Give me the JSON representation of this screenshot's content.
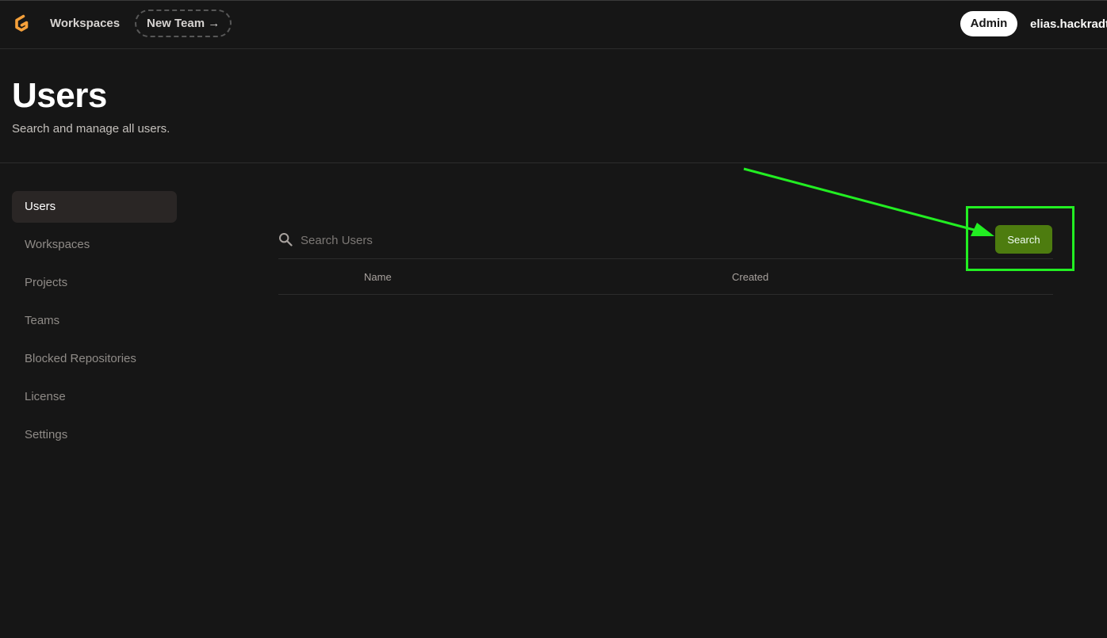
{
  "topnav": {
    "logo_icon": "gitpod-logo-icon",
    "workspaces_label": "Workspaces",
    "new_team_label": "New Team →",
    "admin_label": "Admin",
    "username": "elias.hackradt"
  },
  "header": {
    "title": "Users",
    "subtitle": "Search and manage all users."
  },
  "sidebar": {
    "items": [
      {
        "label": "Users",
        "active": true
      },
      {
        "label": "Workspaces"
      },
      {
        "label": "Projects"
      },
      {
        "label": "Teams"
      },
      {
        "label": "Blocked Repositories"
      },
      {
        "label": "License"
      },
      {
        "label": "Settings"
      }
    ]
  },
  "main": {
    "search": {
      "placeholder": "Search Users",
      "value": "",
      "button_label": "Search",
      "icon": "search-icon"
    },
    "table": {
      "columns": [
        "Name",
        "Created"
      ],
      "rows": []
    }
  },
  "colors": {
    "background": "#161616",
    "accent_orange": "#f5a03a",
    "button_green": "#4d7c0f",
    "annotation_green": "#22ee22"
  }
}
